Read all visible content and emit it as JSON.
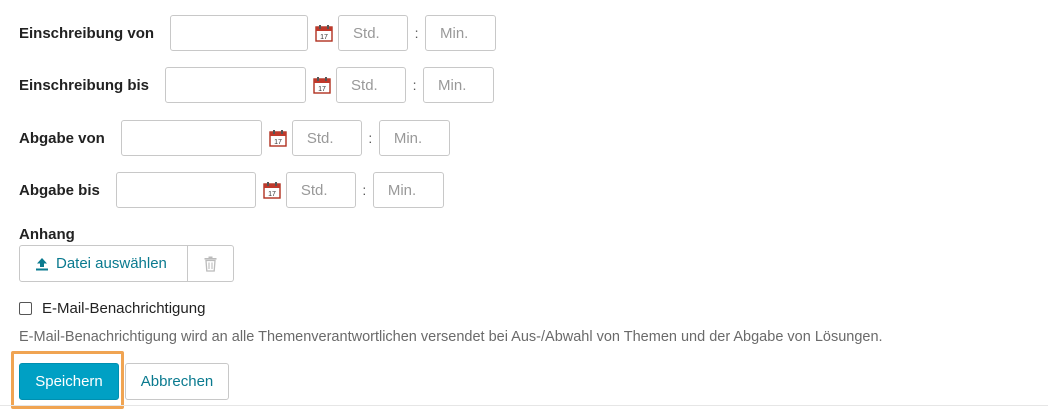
{
  "form": {
    "rows": [
      {
        "label": "Einschreibung von",
        "date_value": "",
        "hour_placeholder": "Std.",
        "minute_placeholder": "Min.",
        "separator": ":"
      },
      {
        "label": "Einschreibung bis",
        "date_value": "",
        "hour_placeholder": "Std.",
        "minute_placeholder": "Min.",
        "separator": ":"
      },
      {
        "label": "Abgabe von",
        "date_value": "",
        "hour_placeholder": "Std.",
        "minute_placeholder": "Min.",
        "separator": ":"
      },
      {
        "label": "Abgabe bis",
        "date_value": "",
        "hour_placeholder": "Std.",
        "minute_placeholder": "Min.",
        "separator": ":"
      }
    ],
    "icons": {
      "calendar": "calendar-icon",
      "upload": "upload-icon",
      "trash": "trash-icon"
    },
    "attachment": {
      "label": "Anhang",
      "upload_label": "Datei auswählen"
    },
    "notification": {
      "checkbox_label": "E-Mail-Benachrichtigung",
      "checked": false,
      "help_text": "E-Mail-Benachrichtigung wird an alle Themenverantwortlichen versendet bei Aus-/Abwahl von Themen und der Abgabe von Lösungen."
    },
    "actions": {
      "save_label": "Speichern",
      "cancel_label": "Abbrechen"
    },
    "colors": {
      "primary": "#00a0c4",
      "link": "#0a7a8f",
      "focus": "#f0a452",
      "calendar_red": "#c0392b"
    }
  }
}
